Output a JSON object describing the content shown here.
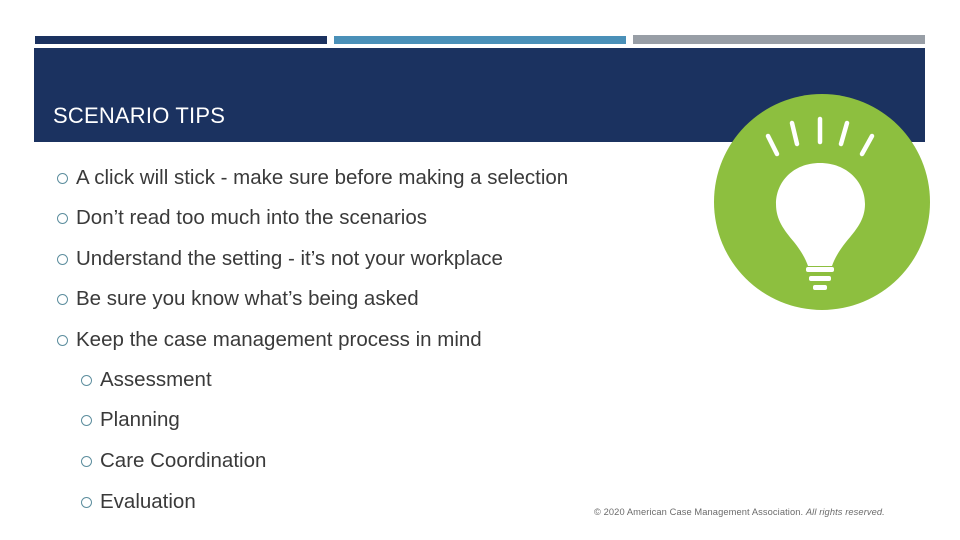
{
  "slide": {
    "title": "SCENARIO TIPS",
    "tips": [
      "A click will stick - make sure before making a selection",
      "Don’t read too much into the scenarios",
      "Understand the setting - it’s not your workplace",
      "Be sure you know what’s being asked",
      "Keep the case management process in mind"
    ],
    "process_steps": [
      "Assessment",
      "Planning",
      "Care Coordination",
      "Evaluation"
    ],
    "footer": {
      "copyright": "© 2020 American Case Management Association.",
      "rights": "All rights reserved."
    },
    "graphic": {
      "icon": "lightbulb-icon",
      "circle_color": "#8dbf3f"
    },
    "colors": {
      "navy": "#1b3260",
      "blue": "#4a90b8",
      "gray": "#989ea6",
      "bullet": "#5d8e9e",
      "text": "#3a3a3a"
    }
  }
}
